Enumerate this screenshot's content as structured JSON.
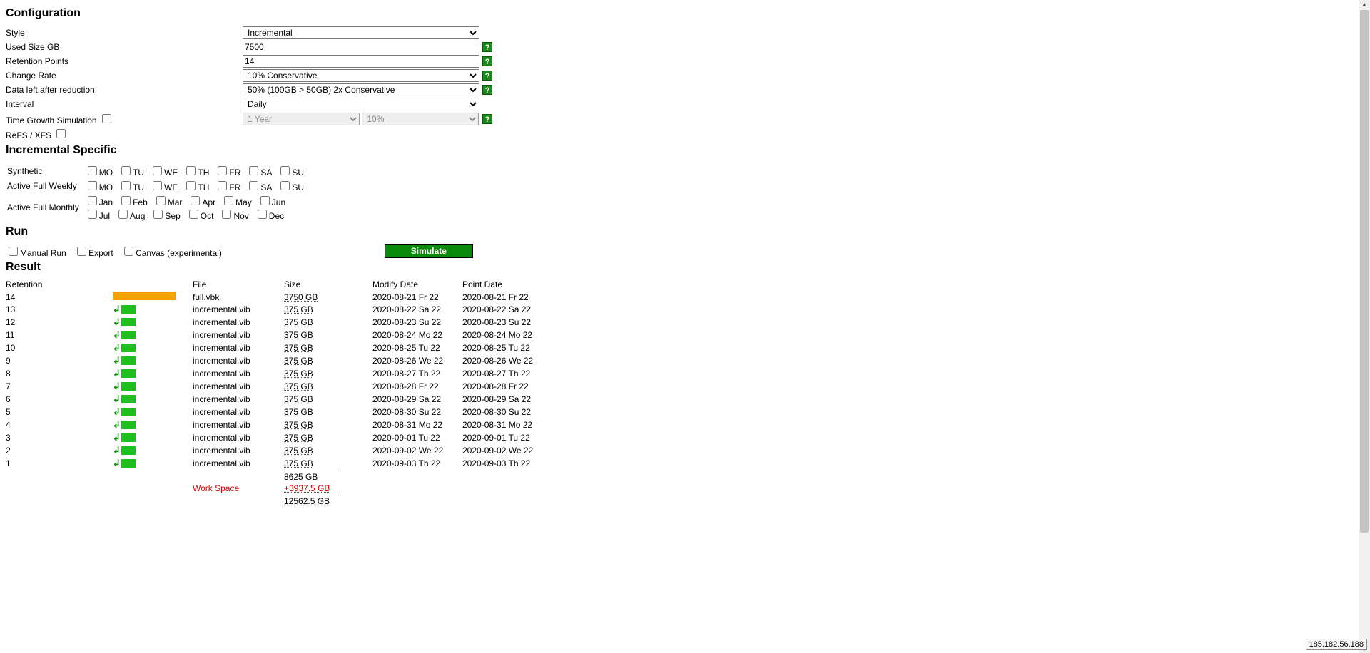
{
  "sections": {
    "config": "Configuration",
    "inc": "Incremental Specific",
    "run": "Run",
    "result": "Result"
  },
  "config": {
    "style_label": "Style",
    "style_value": "Incremental",
    "used_label": "Used Size GB",
    "used_value": "7500",
    "retention_label": "Retention Points",
    "retention_value": "14",
    "change_label": "Change Rate",
    "change_value": "10% Conservative",
    "reduction_label": "Data left after reduction",
    "reduction_value": "50% (100GB > 50GB) 2x Conservative",
    "interval_label": "Interval",
    "interval_value": "Daily",
    "growth_label": "Time Growth Simulation",
    "growth_time": "1 Year",
    "growth_pct": "10%",
    "refs_label": "ReFS / XFS"
  },
  "inc": {
    "synth_label": "Synthetic",
    "weekly_label": "Active Full Weekly",
    "monthly_label": "Active Full Monthly",
    "days": [
      "MO",
      "TU",
      "WE",
      "TH",
      "FR",
      "SA",
      "SU"
    ],
    "months": [
      "Jan",
      "Feb",
      "Mar",
      "Apr",
      "May",
      "Jun",
      "Jul",
      "Aug",
      "Sep",
      "Oct",
      "Nov",
      "Dec"
    ]
  },
  "run": {
    "manual": "Manual Run",
    "export": "Export",
    "canvas": "Canvas (experimental)",
    "simulate": "Simulate"
  },
  "result": {
    "headers": {
      "retention": "Retention",
      "file": "File",
      "size": "Size",
      "modify": "Modify Date",
      "point": "Point Date"
    },
    "rows": [
      {
        "r": "14",
        "type": "full",
        "file": "full.vbk",
        "size": "3750 GB",
        "mod": "2020-08-21 Fr 22",
        "pt": "2020-08-21 Fr 22"
      },
      {
        "r": "13",
        "type": "inc",
        "file": "incremental.vib",
        "size": "375 GB",
        "mod": "2020-08-22 Sa 22",
        "pt": "2020-08-22 Sa 22"
      },
      {
        "r": "12",
        "type": "inc",
        "file": "incremental.vib",
        "size": "375 GB",
        "mod": "2020-08-23 Su 22",
        "pt": "2020-08-23 Su 22"
      },
      {
        "r": "11",
        "type": "inc",
        "file": "incremental.vib",
        "size": "375 GB",
        "mod": "2020-08-24 Mo 22",
        "pt": "2020-08-24 Mo 22"
      },
      {
        "r": "10",
        "type": "inc",
        "file": "incremental.vib",
        "size": "375 GB",
        "mod": "2020-08-25 Tu 22",
        "pt": "2020-08-25 Tu 22"
      },
      {
        "r": "9",
        "type": "inc",
        "file": "incremental.vib",
        "size": "375 GB",
        "mod": "2020-08-26 We 22",
        "pt": "2020-08-26 We 22"
      },
      {
        "r": "8",
        "type": "inc",
        "file": "incremental.vib",
        "size": "375 GB",
        "mod": "2020-08-27 Th 22",
        "pt": "2020-08-27 Th 22"
      },
      {
        "r": "7",
        "type": "inc",
        "file": "incremental.vib",
        "size": "375 GB",
        "mod": "2020-08-28 Fr 22",
        "pt": "2020-08-28 Fr 22"
      },
      {
        "r": "6",
        "type": "inc",
        "file": "incremental.vib",
        "size": "375 GB",
        "mod": "2020-08-29 Sa 22",
        "pt": "2020-08-29 Sa 22"
      },
      {
        "r": "5",
        "type": "inc",
        "file": "incremental.vib",
        "size": "375 GB",
        "mod": "2020-08-30 Su 22",
        "pt": "2020-08-30 Su 22"
      },
      {
        "r": "4",
        "type": "inc",
        "file": "incremental.vib",
        "size": "375 GB",
        "mod": "2020-08-31 Mo 22",
        "pt": "2020-08-31 Mo 22"
      },
      {
        "r": "3",
        "type": "inc",
        "file": "incremental.vib",
        "size": "375 GB",
        "mod": "2020-09-01 Tu 22",
        "pt": "2020-09-01 Tu 22"
      },
      {
        "r": "2",
        "type": "inc",
        "file": "incremental.vib",
        "size": "375 GB",
        "mod": "2020-09-02 We 22",
        "pt": "2020-09-02 We 22"
      },
      {
        "r": "1",
        "type": "inc",
        "file": "incremental.vib",
        "size": "375 GB",
        "mod": "2020-09-03 Th 22",
        "pt": "2020-09-03 Th 22"
      }
    ],
    "subtotal": "8625 GB",
    "workspace_label": "Work Space",
    "workspace_value": "+3937.5 GB",
    "total": "12562.5 GB"
  },
  "help": "?",
  "ip": "185.182.56.188"
}
